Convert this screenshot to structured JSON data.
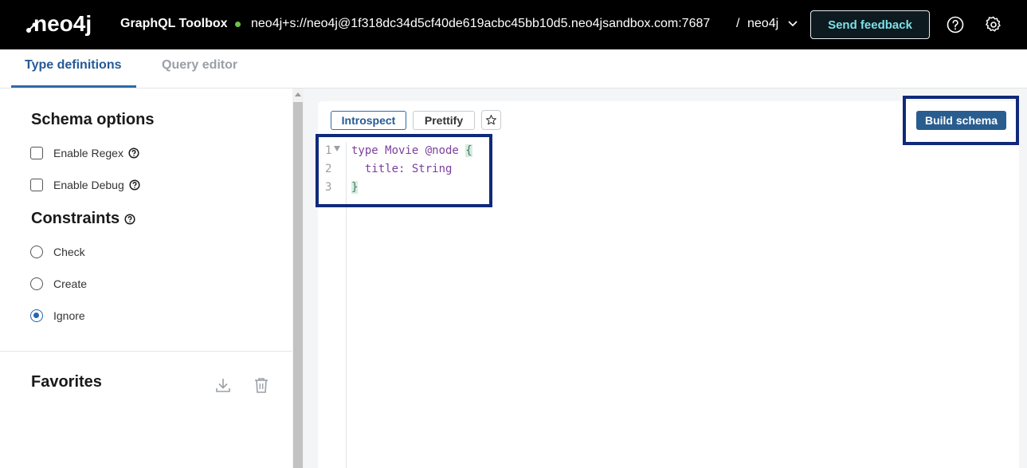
{
  "header": {
    "logo_text": "neo4j",
    "app_title": "GraphQL Toolbox",
    "connection_url": "neo4j+s://neo4j@1f318dc34d5cf40de619acbc45bb10d5.neo4jsandbox.com:7687",
    "separator": "/",
    "database": "neo4j",
    "feedback_label": "Send feedback",
    "status_color": "#6cc24a"
  },
  "tabs": [
    {
      "label": "Type definitions",
      "active": true
    },
    {
      "label": "Query editor",
      "active": false
    }
  ],
  "sidebar": {
    "schema_options_title": "Schema options",
    "schema_options": [
      {
        "label": "Enable Regex",
        "checked": false
      },
      {
        "label": "Enable Debug",
        "checked": false
      }
    ],
    "constraints_title": "Constraints",
    "constraints": [
      {
        "label": "Check",
        "selected": false
      },
      {
        "label": "Create",
        "selected": false
      },
      {
        "label": "Ignore",
        "selected": true
      }
    ],
    "favorites_title": "Favorites"
  },
  "editor": {
    "introspect_label": "Introspect",
    "prettify_label": "Prettify",
    "build_label": "Build schema",
    "lines": [
      {
        "num": "1",
        "kw": "type Movie @node ",
        "brace": "{"
      },
      {
        "num": "2",
        "kw": "  title: String",
        "brace": ""
      },
      {
        "num": "3",
        "kw": "",
        "brace": "}"
      }
    ]
  },
  "colors": {
    "accent": "#2e6ca8",
    "build_button": "#2a5d8f",
    "highlight_frame": "#0f2a7a"
  }
}
